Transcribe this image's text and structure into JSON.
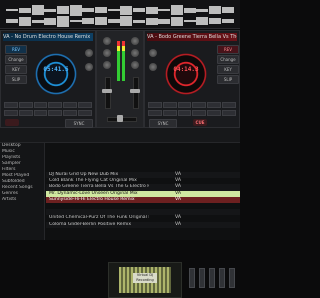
{
  "decks": {
    "left": {
      "title": "VA - No Drum Electro House Remix",
      "time": "05:41.5",
      "secondary_time": "00:11.2",
      "buttons": [
        "REV",
        "Change",
        "KEY",
        "SLIP",
        "LOOP",
        "SYNC"
      ]
    },
    "right": {
      "title": "VA - Bodo Greene Tierra Bella Vs The G Electro Re",
      "time": "04:14.3",
      "secondary_time": "00:08.1",
      "buttons": [
        "REV",
        "Change",
        "KEY",
        "SLIP",
        "LOOP",
        "SYNC"
      ],
      "cue_label": "CUE"
    }
  },
  "mixer": {
    "label": "MIX"
  },
  "browser": {
    "folders": [
      "Desktop",
      "Music",
      "Playlists",
      "Sampler",
      "Filters",
      "Most Played",
      "Subfolded",
      "Recent Songs",
      "Genres",
      "Artists"
    ],
    "preview_label": "Virtual DJ Recording",
    "tracks": [
      {
        "title": "DJ Nurai Grid Up New Dub Mix",
        "artist": "VA"
      },
      {
        "title": "Cold Blank The Flying Cat Original Mix",
        "artist": "VA"
      },
      {
        "title": "Bodo Greene Tierra Bella Vs The G Electro Re",
        "artist": "VA"
      },
      {
        "title": "Mr. Dynamic-Love Unseen Original Mix",
        "artist": "VA"
      },
      {
        "title": "Sunnyside-Hi-Hi Electro House Remix",
        "artist": "VA"
      },
      {
        "title": "",
        "artist": ""
      },
      {
        "title": "",
        "artist": ""
      },
      {
        "title": "United Chemical-Purz Of The Funk Original Mix",
        "artist": "VA"
      },
      {
        "title": "Coloma Glider-Berlin Positive Remix",
        "artist": "VA"
      }
    ]
  }
}
